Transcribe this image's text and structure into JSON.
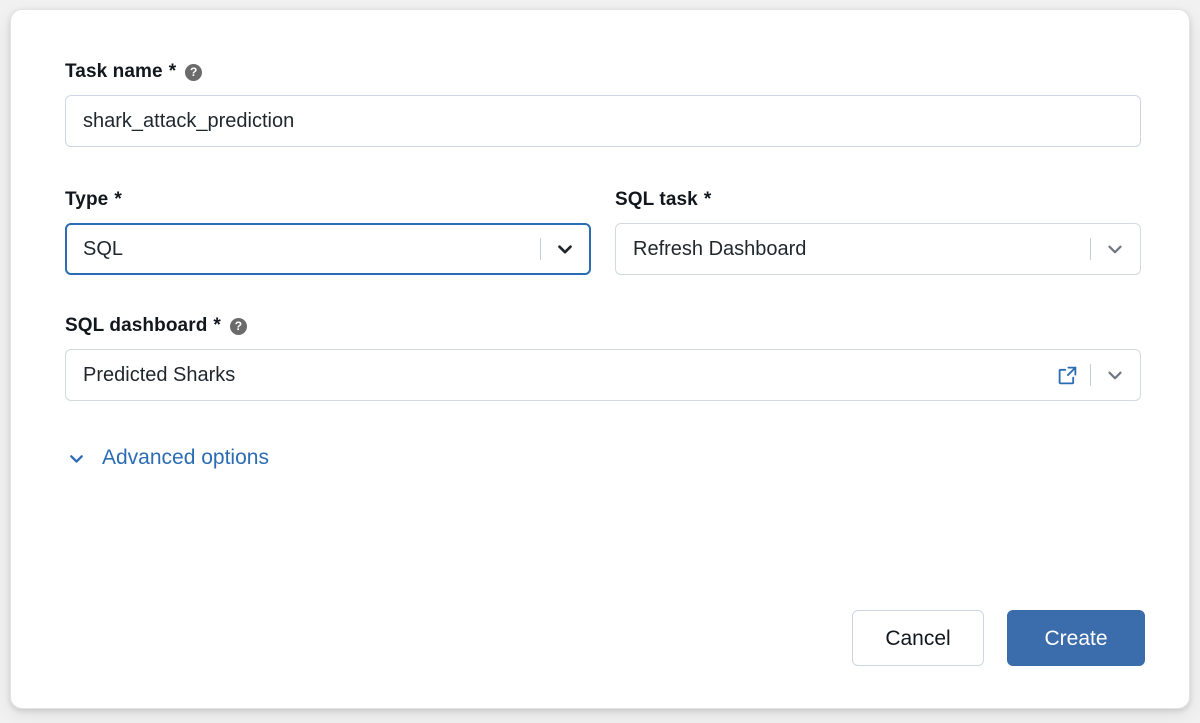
{
  "dialog": {
    "fields": {
      "task_name": {
        "label": "Task name",
        "required_mark": "*",
        "help_icon": "help-circle-icon",
        "value": "shark_attack_prediction",
        "placeholder": "Task name"
      },
      "type": {
        "label": "Type",
        "required_mark": "*",
        "value": "SQL",
        "chevron_icon": "chevron-down-icon"
      },
      "sql_task": {
        "label": "SQL task",
        "required_mark": "*",
        "value": "Refresh Dashboard",
        "chevron_icon": "chevron-down-icon"
      },
      "sql_dashboard": {
        "label": "SQL dashboard",
        "required_mark": "*",
        "help_icon": "help-circle-icon",
        "value": "Predicted Sharks",
        "external_link_icon": "external-link-icon",
        "chevron_icon": "chevron-down-icon"
      }
    },
    "advanced_options": {
      "label": "Advanced options",
      "chevron_icon": "chevron-down-icon"
    },
    "footer": {
      "cancel_label": "Cancel",
      "create_label": "Create"
    }
  },
  "colors": {
    "primary_blue": "#3b6cab",
    "focus_blue": "#2b6cb4",
    "link_blue": "#2c6cb3",
    "input_border": "#ccd7e3",
    "help_icon_gray": "#6b6b6b",
    "page_background": "#f1f1f1",
    "card_background": "#ffffff"
  }
}
